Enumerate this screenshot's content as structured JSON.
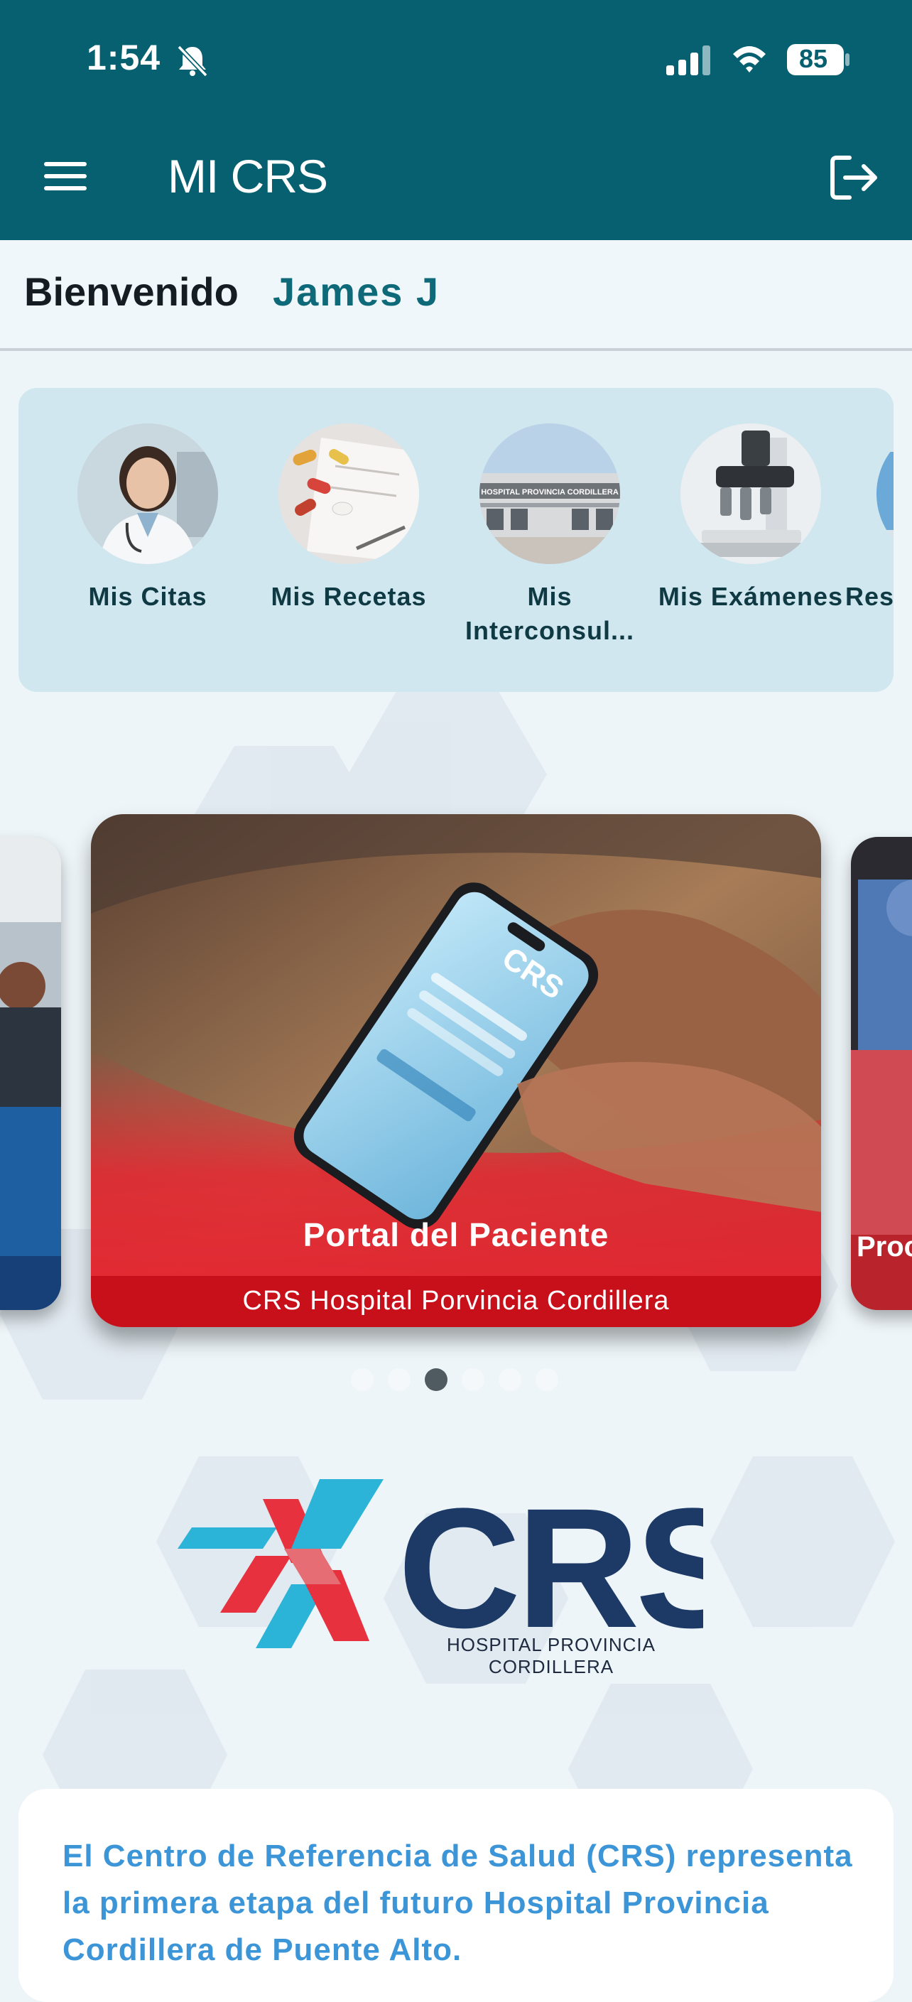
{
  "status_bar": {
    "time": "1:54",
    "battery": "85",
    "icons": [
      "bell-slash-icon",
      "signal-icon",
      "wifi-icon",
      "battery-icon"
    ]
  },
  "app_bar": {
    "title": "MI CRS",
    "menu_icon": "hamburger-menu-icon",
    "logout_icon": "logout-icon"
  },
  "welcome": {
    "label": "Bienvenido",
    "name": "James J"
  },
  "quick_access": {
    "items": [
      {
        "label": "Mis Citas",
        "icon": "doctor-photo"
      },
      {
        "label": "Mis Recetas",
        "icon": "pills-photo"
      },
      {
        "label": "Mis Interconsul...",
        "icon": "hospital-building-photo"
      },
      {
        "label": "Mis Exámenes",
        "icon": "microscope-photo"
      },
      {
        "label": "Res",
        "icon": "partial-photo"
      }
    ]
  },
  "carousel": {
    "main": {
      "title": "Portal del Paciente",
      "subtitle": "CRS Hospital Porvincia Cordillera"
    },
    "right_peek_label": "Proc",
    "dot_count": 6,
    "active_dot": 2
  },
  "logo": {
    "text": "CRS",
    "subtitle": "HOSPITAL PROVINCIA CORDILLERA"
  },
  "info": {
    "text": "El Centro de Referencia de Salud (CRS) representa la primera etapa del futuro Hospital Provincia Cordillera de Puente Alto."
  },
  "colors": {
    "header": "#066070",
    "accent_name": "#0e6a79",
    "quick_panel": "#d1e7ef",
    "card_red": "#e52631",
    "info_text": "#3c95d7",
    "logo_navy": "#1d3a66",
    "logo_red": "#e8313f",
    "logo_cyan": "#2cb4d8"
  }
}
